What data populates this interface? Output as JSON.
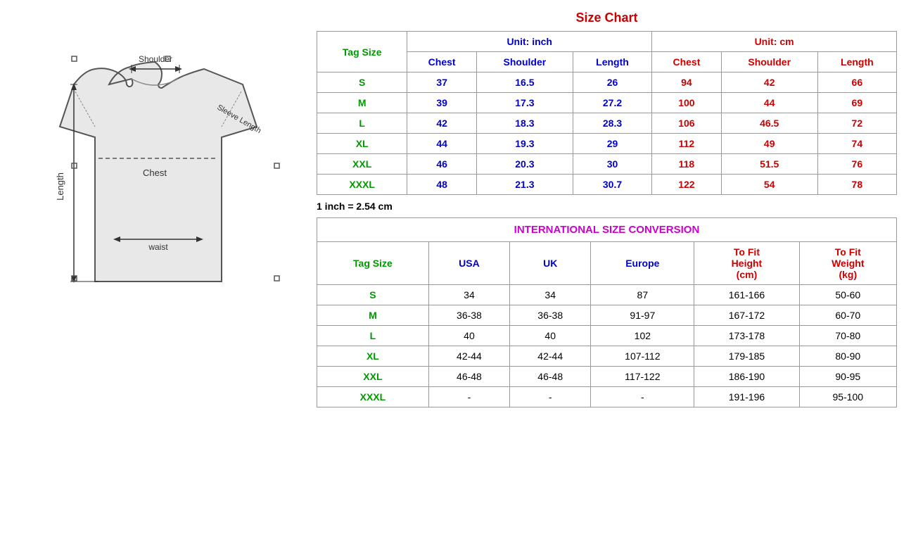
{
  "title": "Size Chart",
  "inch_label": "Unit: inch",
  "cm_label": "Unit: cm",
  "tag_size_label": "Tag Size",
  "columns_inch": [
    "Chest",
    "Shoulder",
    "Length"
  ],
  "columns_cm": [
    "Chest",
    "Shoulder",
    "Length"
  ],
  "size_rows": [
    {
      "tag": "S",
      "inch_chest": "37",
      "inch_shoulder": "16.5",
      "inch_length": "26",
      "cm_chest": "94",
      "cm_shoulder": "42",
      "cm_length": "66"
    },
    {
      "tag": "M",
      "inch_chest": "39",
      "inch_shoulder": "17.3",
      "inch_length": "27.2",
      "cm_chest": "100",
      "cm_shoulder": "44",
      "cm_length": "69"
    },
    {
      "tag": "L",
      "inch_chest": "42",
      "inch_shoulder": "18.3",
      "inch_length": "28.3",
      "cm_chest": "106",
      "cm_shoulder": "46.5",
      "cm_length": "72"
    },
    {
      "tag": "XL",
      "inch_chest": "44",
      "inch_shoulder": "19.3",
      "inch_length": "29",
      "cm_chest": "112",
      "cm_shoulder": "49",
      "cm_length": "74"
    },
    {
      "tag": "XXL",
      "inch_chest": "46",
      "inch_shoulder": "20.3",
      "inch_length": "30",
      "cm_chest": "118",
      "cm_shoulder": "51.5",
      "cm_length": "76"
    },
    {
      "tag": "XXXL",
      "inch_chest": "48",
      "inch_shoulder": "21.3",
      "inch_length": "30.7",
      "cm_chest": "122",
      "cm_shoulder": "54",
      "cm_length": "78"
    }
  ],
  "conversion_note": "1 inch = 2.54 cm",
  "intl_title": "INTERNATIONAL SIZE CONVERSION",
  "intl_columns": [
    "Tag Size",
    "USA",
    "UK",
    "Europe",
    "To Fit Height (cm)",
    "To Fit Weight (kg)"
  ],
  "intl_rows": [
    {
      "tag": "S",
      "usa": "34",
      "uk": "34",
      "europe": "87",
      "height": "161-166",
      "weight": "50-60"
    },
    {
      "tag": "M",
      "usa": "36-38",
      "uk": "36-38",
      "europe": "91-97",
      "height": "167-172",
      "weight": "60-70"
    },
    {
      "tag": "L",
      "usa": "40",
      "uk": "40",
      "europe": "102",
      "height": "173-178",
      "weight": "70-80"
    },
    {
      "tag": "XL",
      "usa": "42-44",
      "uk": "42-44",
      "europe": "107-112",
      "height": "179-185",
      "weight": "80-90"
    },
    {
      "tag": "XXL",
      "usa": "46-48",
      "uk": "46-48",
      "europe": "117-122",
      "height": "186-190",
      "weight": "90-95"
    },
    {
      "tag": "XXXL",
      "usa": "-",
      "uk": "-",
      "europe": "-",
      "height": "191-196",
      "weight": "95-100"
    }
  ],
  "diagram_labels": {
    "shoulder": "Shoulder",
    "sleeve_length": "Sleeve Length",
    "chest": "Chest",
    "length": "Length",
    "waist": "waist"
  }
}
